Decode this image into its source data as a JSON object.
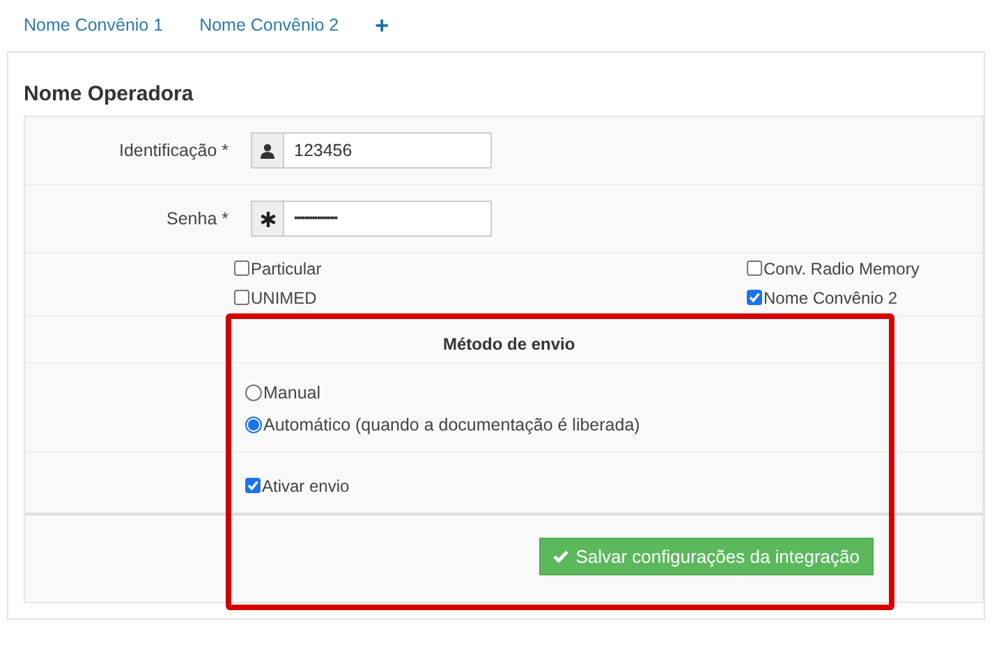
{
  "tabs": [
    {
      "label": "Nome Convênio 1"
    },
    {
      "label": "Nome Convênio 2"
    },
    {
      "label": "+"
    }
  ],
  "panel": {
    "title": "Nome Operadora",
    "fields": [
      {
        "label": "Identificação *",
        "kind": "user",
        "value": "123456"
      },
      {
        "label": "Senha *",
        "kind": "password",
        "value": "•••••••••••••••••"
      }
    ],
    "plans_left": [
      {
        "label": "Particular",
        "checked": false
      },
      {
        "label": "UNIMED",
        "checked": false
      }
    ],
    "plans_right": [
      {
        "label": "Conv. Radio Memory",
        "checked": false
      },
      {
        "label": "Nome Convênio 2",
        "checked": true
      }
    ],
    "send_method": {
      "title": "Método de envio",
      "options": [
        {
          "label": "Manual",
          "selected": false
        },
        {
          "label": "Automático (quando a documentação é liberada)",
          "selected": true
        }
      ]
    },
    "activate": {
      "label": "Ativar envio",
      "checked": true
    },
    "save_button": "Salvar configurações da integração"
  }
}
